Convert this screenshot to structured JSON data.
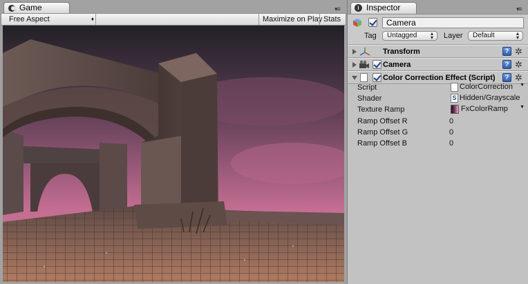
{
  "game": {
    "tab_label": "Game",
    "toolbar": {
      "aspect": "Free Aspect",
      "maximize": "Maximize on Play",
      "stats": "Stats"
    }
  },
  "inspector": {
    "tab_label": "Inspector",
    "object_name": "Camera",
    "tag_label": "Tag",
    "tag_value": "Untagged",
    "layer_label": "Layer",
    "layer_value": "Default",
    "components": {
      "transform": "Transform",
      "camera": "Camera",
      "color_correction": "Color Correction Effect (Script)"
    },
    "help_glyph": "?",
    "gear_glyph": "✲",
    "properties": {
      "script_label": "Script",
      "script_value": "ColorCorrection",
      "shader_label": "Shader",
      "shader_value": "Hidden/Grayscale",
      "ramp_label": "Texture Ramp",
      "ramp_value": "FxColorRamp",
      "offset_r_label": "Ramp Offset R",
      "offset_r_value": "0",
      "offset_g_label": "Ramp Offset G",
      "offset_g_value": "0",
      "offset_b_label": "Ramp Offset B",
      "offset_b_value": "0"
    }
  },
  "colors": {
    "panel_bg": "#c2c2c2",
    "sky_pink": "#c06a8c",
    "help_blue": "#2d5fb0"
  }
}
